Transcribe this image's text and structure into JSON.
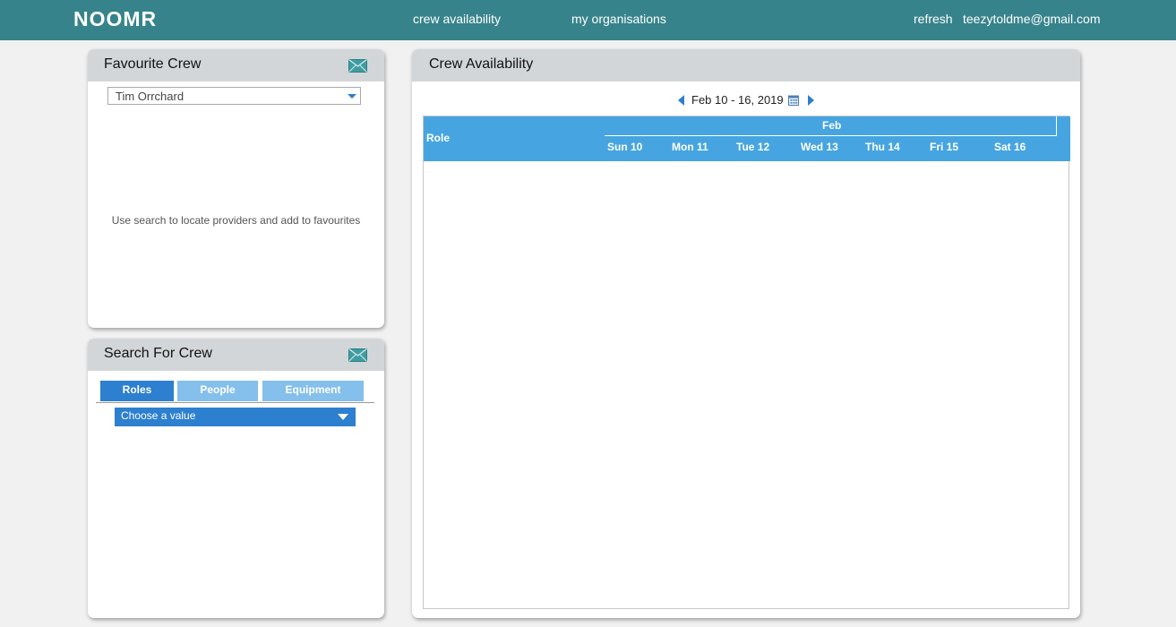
{
  "app": {
    "logo": "NOOMR"
  },
  "nav": {
    "crew_availability": "crew availability",
    "my_organisations": "my organisations",
    "refresh": "refresh",
    "user_email": "teezytoldme@gmail.com"
  },
  "favourite_crew": {
    "title": "Favourite Crew",
    "selected": "Tim Orrchard",
    "hint": "Use search to locate providers and add to favourites"
  },
  "search_crew": {
    "title": "Search For Crew",
    "tabs": [
      {
        "label": "Roles",
        "active": true
      },
      {
        "label": "People",
        "active": false
      },
      {
        "label": "Equipment",
        "active": false
      }
    ],
    "dropdown_placeholder": "Choose a value"
  },
  "availability": {
    "title": "Crew Availability",
    "date_range": "Feb 10 - 16, 2019",
    "role_header": "Role",
    "month": "Feb",
    "days": [
      "Sun 10",
      "Mon 11",
      "Tue 12",
      "Wed 13",
      "Thu 14",
      "Fri 15",
      "Sat 16"
    ]
  },
  "colors": {
    "topbar": "#36838b",
    "panel_header": "#d3d6d9",
    "grid_header": "#46a5e0",
    "active_tab": "#2d7fcf",
    "inactive_tab": "#85bfec"
  }
}
